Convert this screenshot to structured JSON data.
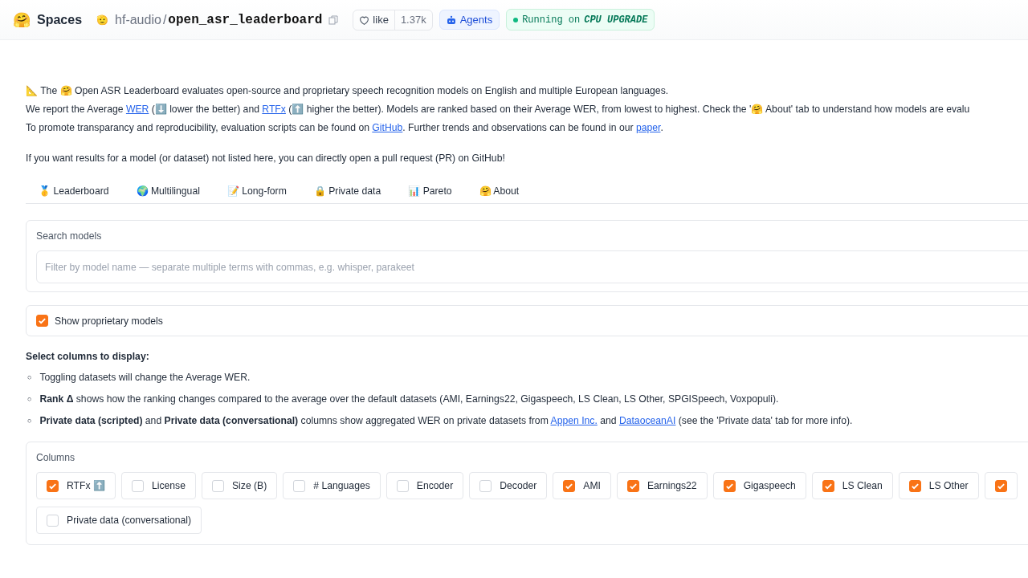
{
  "header": {
    "logo": "🤗",
    "brand": "Spaces",
    "owner_icon": "🫡",
    "owner": "hf-audio",
    "separator": "/",
    "repo": "open_asr_leaderboard",
    "like": {
      "label": "like",
      "count": "1.37k"
    },
    "agents": "Agents",
    "status": {
      "prefix": "Running on",
      "hardware": "CPU UPGRADE"
    }
  },
  "intro": [
    [
      {
        "text": "📐 The 🤗 Open ASR Leaderboard evaluates open-source and proprietary speech recognition models on English and multiple European languages."
      }
    ],
    [
      {
        "text": "We report the Average "
      },
      {
        "link": "WER"
      },
      {
        "text": " (⬇️ lower the better) and "
      },
      {
        "link": "RTFx"
      },
      {
        "text": " (⬆️ higher the better). Models are ranked based on their Average WER, from lowest to highest. Check the '🤗 About' tab to understand how models are evalu"
      }
    ],
    [
      {
        "text": "To promote transparancy and reproducibility, evaluation scripts can be found on "
      },
      {
        "link": "GitHub"
      },
      {
        "text": ". Further trends and observations can be found in our "
      },
      {
        "link": "paper"
      },
      {
        "text": "."
      }
    ]
  ],
  "note": "If you want results for a model (or dataset) not listed here, you can directly open a pull request (PR) on GitHub!",
  "tabs": [
    {
      "icon": "🥇",
      "label": "Leaderboard"
    },
    {
      "icon": "🌍",
      "label": "Multilingual"
    },
    {
      "icon": "📝",
      "label": "Long-form"
    },
    {
      "icon": "🔒",
      "label": "Private data"
    },
    {
      "icon": "📊",
      "label": "Pareto"
    },
    {
      "icon": "🤗",
      "label": "About"
    }
  ],
  "search": {
    "label": "Search models",
    "placeholder": "Filter by model name — separate multiple terms with commas, e.g. whisper, parakeet"
  },
  "show_proprietary": {
    "label": "Show proprietary models",
    "checked": true
  },
  "select_title": "Select columns to display:",
  "bullets": [
    {
      "marker": "○",
      "parts": [
        {
          "text": "Toggling datasets will change the Average WER."
        }
      ]
    },
    {
      "marker": "○",
      "parts": [
        {
          "text": "**Rank Δ** shows how the ranking changes compared to the average over the default datasets (AMI, Earnings22, Gigaspeech, LS Clean, LS Other, SPGISpeech, Voxpopuli)."
        }
      ]
    },
    {
      "marker": "○",
      "parts": [
        {
          "text": "**Private data (scripted)** and **Private data (conversational)** columns show aggregated WER on private datasets from "
        },
        {
          "link": "Appen Inc."
        },
        {
          "text": " and "
        },
        {
          "link": "DataoceanAI"
        },
        {
          "text": " (see the 'Private data' tab for more info)."
        }
      ]
    }
  ],
  "columns": {
    "label": "Columns",
    "rows": [
      [
        {
          "label": "RTFx ⬆️",
          "checked": true
        },
        {
          "label": "License",
          "checked": false
        },
        {
          "label": "Size (B)",
          "checked": false
        },
        {
          "label": "# Languages",
          "checked": false
        },
        {
          "label": "Encoder",
          "checked": false
        },
        {
          "label": "Decoder",
          "checked": false
        },
        {
          "label": "AMI",
          "checked": true
        },
        {
          "label": "Earnings22",
          "checked": true
        },
        {
          "label": "Gigaspeech",
          "checked": true
        },
        {
          "label": "LS Clean",
          "checked": true
        },
        {
          "label": "LS Other",
          "checked": true
        },
        {
          "checked": true
        }
      ],
      [
        {
          "label": "Private data (conversational)",
          "checked": false
        }
      ]
    ]
  }
}
